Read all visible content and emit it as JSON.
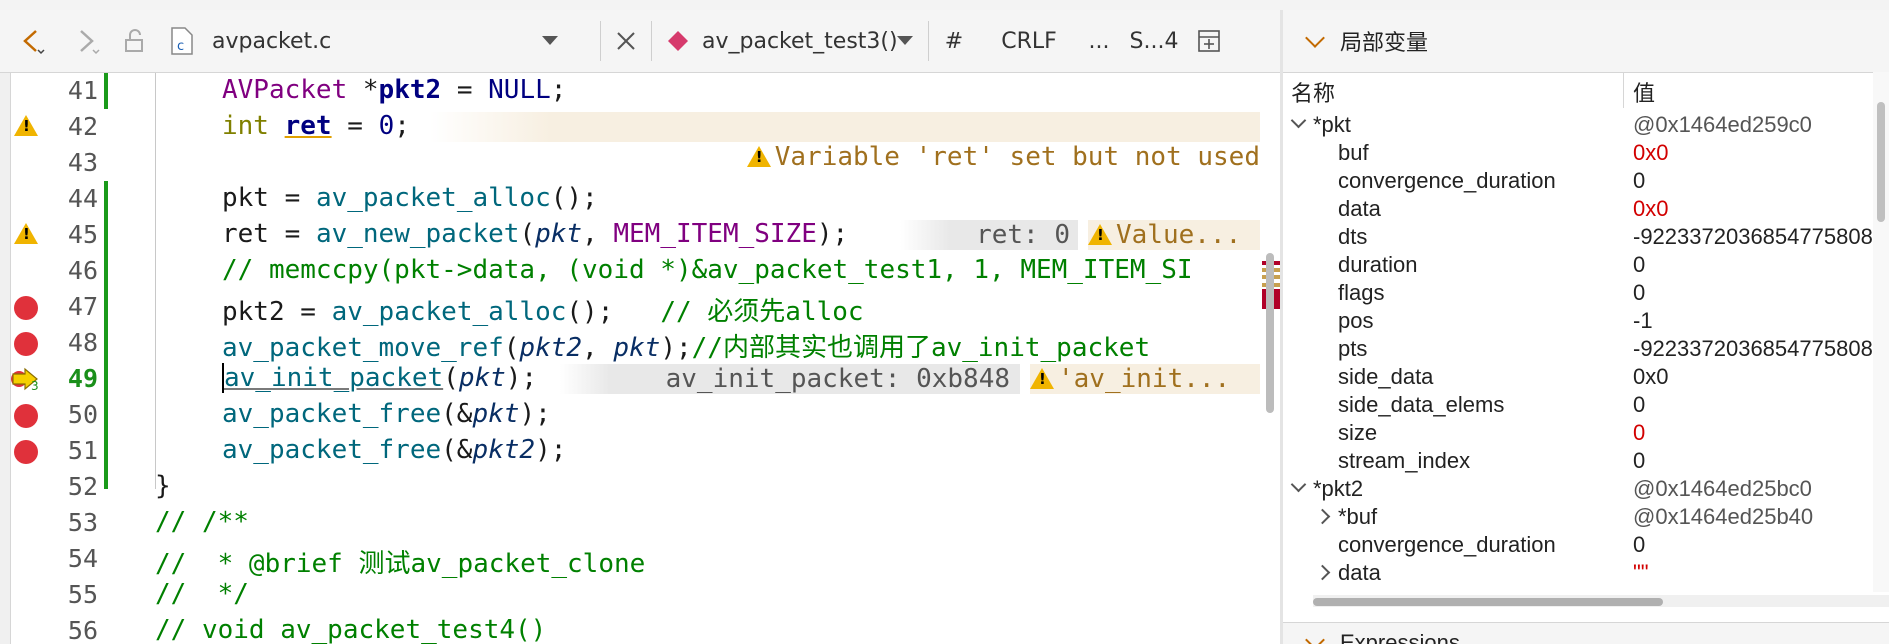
{
  "toolbar": {
    "back_icon": "chevron-left-icon",
    "forward_icon": "chevron-right-icon",
    "lock_icon": "unlock-icon",
    "file_icon": "c-file-icon",
    "file_name": "avpacket.c",
    "close_icon": "close-icon",
    "symbol_icon": "function-symbol-icon",
    "symbol_name": "av_packet_test3()...",
    "hash": "#",
    "line_ending": "CRLF",
    "ellipsis": "...",
    "split_label": "S...4",
    "add_split_icon": "add-split-icon"
  },
  "editor": {
    "lines": [
      {
        "num": "41"
      },
      {
        "num": "42"
      },
      {
        "num": "43"
      },
      {
        "num": "44"
      },
      {
        "num": "45"
      },
      {
        "num": "46"
      },
      {
        "num": "47"
      },
      {
        "num": "48"
      },
      {
        "num": "49"
      },
      {
        "num": "50"
      },
      {
        "num": "51"
      },
      {
        "num": "52"
      },
      {
        "num": "53"
      },
      {
        "num": "54"
      },
      {
        "num": "55"
      },
      {
        "num": "56"
      }
    ],
    "code": {
      "l41_a": "AVPacket ",
      "l41_b": "*",
      "l41_c": "pkt2",
      "l41_d": " = ",
      "l41_e": "NULL",
      "l41_f": ";",
      "l42_a": "int ",
      "l42_b": "ret",
      "l42_c": " = ",
      "l42_d": "0",
      "l42_e": ";",
      "l42_hint": "Variable 'ret' set but not used",
      "l44_a": "pkt",
      "l44_b": " = ",
      "l44_c": "av_packet_alloc",
      "l44_d": "();",
      "l45_a": "ret",
      "l45_b": " = ",
      "l45_c": "av_new_packet",
      "l45_d": "(",
      "l45_e": "pkt",
      "l45_f": ", ",
      "l45_g": "MEM_ITEM_SIZE",
      "l45_h": ");",
      "l45_hint1": "ret: 0",
      "l45_hint2": "Value...",
      "l46": "// memccpy(pkt->data, (void *)&av_packet_test1, 1, MEM_ITEM_SI",
      "l47_a": "pkt2",
      "l47_b": " = ",
      "l47_c": "av_packet_alloc",
      "l47_d": "();   ",
      "l47_e": "// 必须先alloc",
      "l48_a": "av_packet_move_ref",
      "l48_b": "(",
      "l48_c": "pkt2",
      "l48_d": ", ",
      "l48_e": "pkt",
      "l48_f": ");",
      "l48_g": "//内部其实也调用了av_init_packet",
      "l49_a": "av_init_packet",
      "l49_b": "(",
      "l49_c": "pkt",
      "l49_d": ");",
      "l49_hint1": "av_init_packet: 0xb848",
      "l49_hint2": "'av_init...",
      "l50_a": "av_packet_free",
      "l50_b": "(&",
      "l50_c": "pkt",
      "l50_d": ");",
      "l51_a": "av_packet_free",
      "l51_b": "(&",
      "l51_c": "pkt2",
      "l51_d": ");",
      "l52": "}",
      "l53": "// /**",
      "l54": "//  * @brief 测试av_packet_clone",
      "l55": "//  */",
      "l56": "// void av_packet_test4()"
    },
    "current_frame_index": "3"
  },
  "locals": {
    "title": "局部变量",
    "col_name": "名称",
    "col_value": "值",
    "rows": [
      {
        "name": "*pkt",
        "value": "@0x1464ed259c0"
      },
      {
        "name": "buf",
        "value": "0x0"
      },
      {
        "name": "convergence_duration",
        "value": "0"
      },
      {
        "name": "data",
        "value": "0x0"
      },
      {
        "name": "dts",
        "value": "-9223372036854775808"
      },
      {
        "name": "duration",
        "value": "0"
      },
      {
        "name": "flags",
        "value": "0"
      },
      {
        "name": "pos",
        "value": "-1"
      },
      {
        "name": "pts",
        "value": "-9223372036854775808"
      },
      {
        "name": "side_data",
        "value": "0x0"
      },
      {
        "name": "side_data_elems",
        "value": "0"
      },
      {
        "name": "size",
        "value": "0"
      },
      {
        "name": "stream_index",
        "value": "0"
      },
      {
        "name": "*pkt2",
        "value": "@0x1464ed25bc0"
      },
      {
        "name": "*buf",
        "value": "@0x1464ed25b40"
      },
      {
        "name": "convergence_duration",
        "value": "0"
      },
      {
        "name": "data",
        "value": "\"\""
      }
    ]
  },
  "expressions": {
    "title": "Expressions"
  },
  "colors": {
    "breakpoint": "#e0313b",
    "changed_value": "#d20000",
    "warning": "#f0b400",
    "change_bar": "#1a9a1a"
  }
}
